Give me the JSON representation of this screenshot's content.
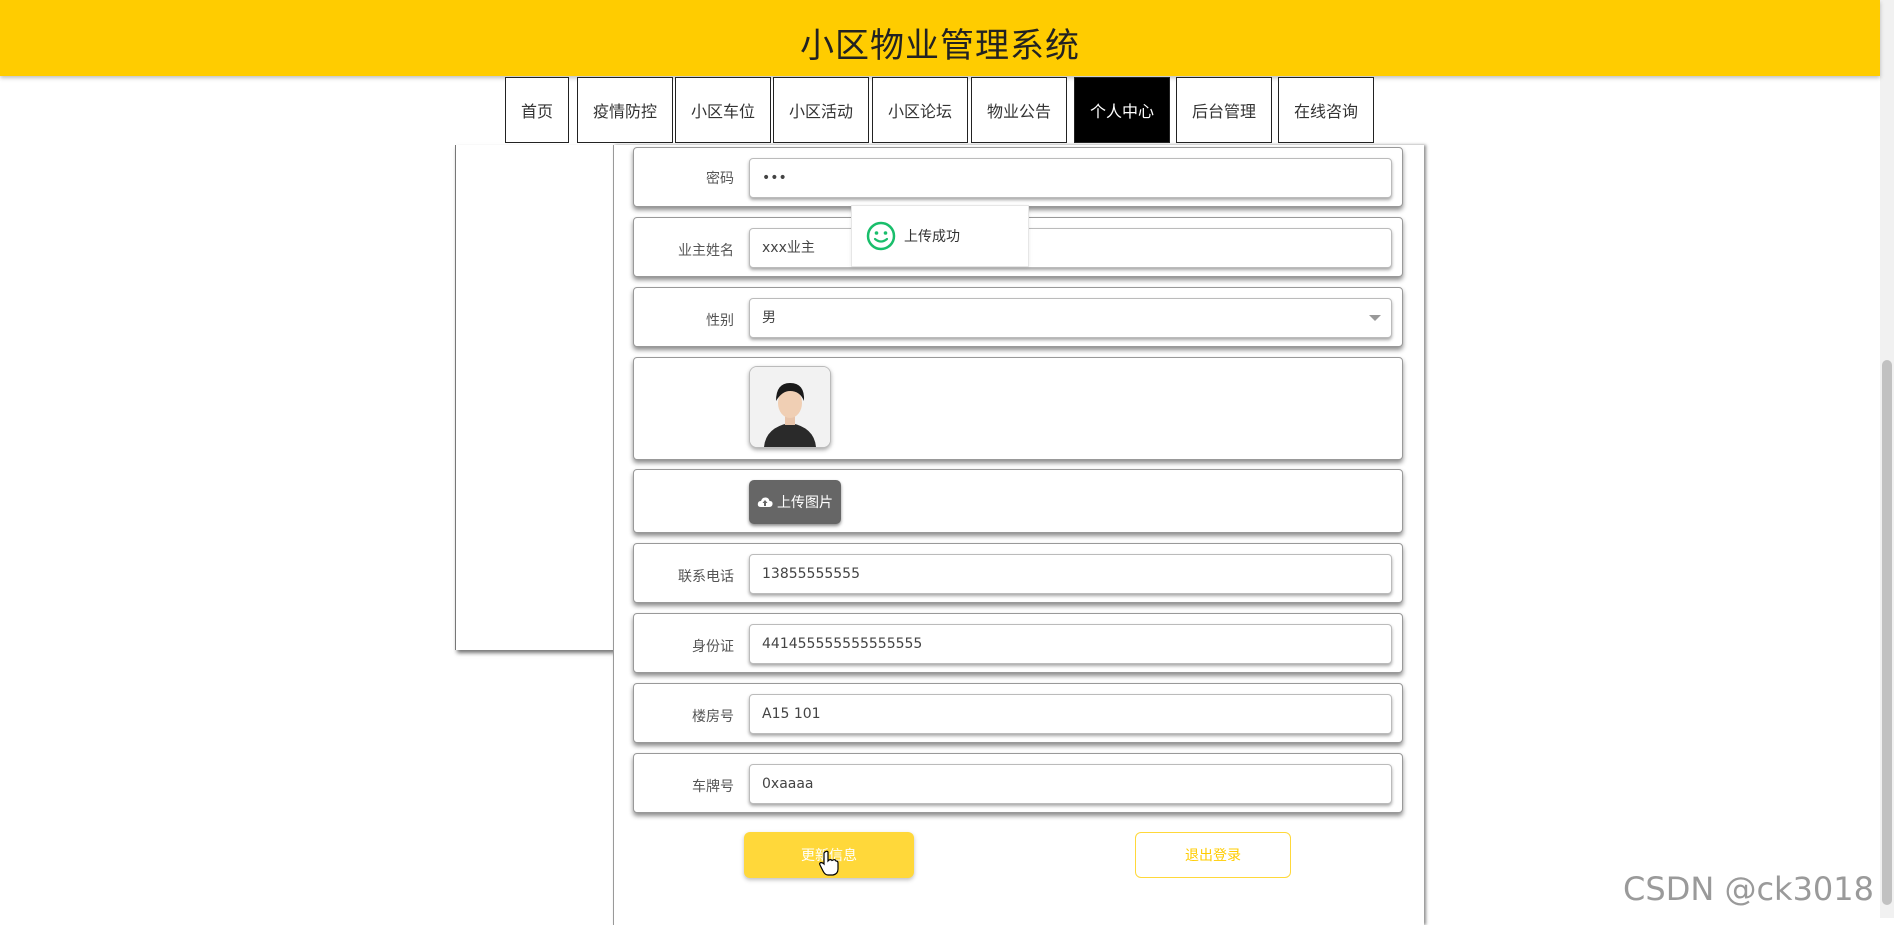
{
  "header": {
    "title": "小区物业管理系统"
  },
  "nav": {
    "items": [
      {
        "label": "首页"
      },
      {
        "label": "疫情防控"
      },
      {
        "label": "小区车位"
      },
      {
        "label": "小区活动"
      },
      {
        "label": "小区论坛"
      },
      {
        "label": "物业公告"
      },
      {
        "label": "个人中心",
        "active": true
      },
      {
        "label": "后台管理"
      },
      {
        "label": "在线咨询"
      }
    ]
  },
  "form": {
    "password": {
      "label": "密码",
      "value": "•••"
    },
    "owner_name": {
      "label": "业主姓名",
      "value": "xxx业主"
    },
    "gender": {
      "label": "性别",
      "value": "男"
    },
    "upload": {
      "button_label": "上传图片"
    },
    "phone": {
      "label": "联系电话",
      "value": "13855555555"
    },
    "id_card": {
      "label": "身份证",
      "value": "441455555555555555"
    },
    "room": {
      "label": "楼房号",
      "value": "A15 101"
    },
    "plate": {
      "label": "车牌号",
      "value": "0xaaaa"
    }
  },
  "toast": {
    "message": "上传成功"
  },
  "actions": {
    "update_label": "更新信息",
    "logout_label": "退出登录"
  },
  "watermark": "CSDN @ck3018",
  "colors": {
    "accent": "#ffcc00",
    "button_yellow": "#ffd83a",
    "success": "#19be6b"
  }
}
